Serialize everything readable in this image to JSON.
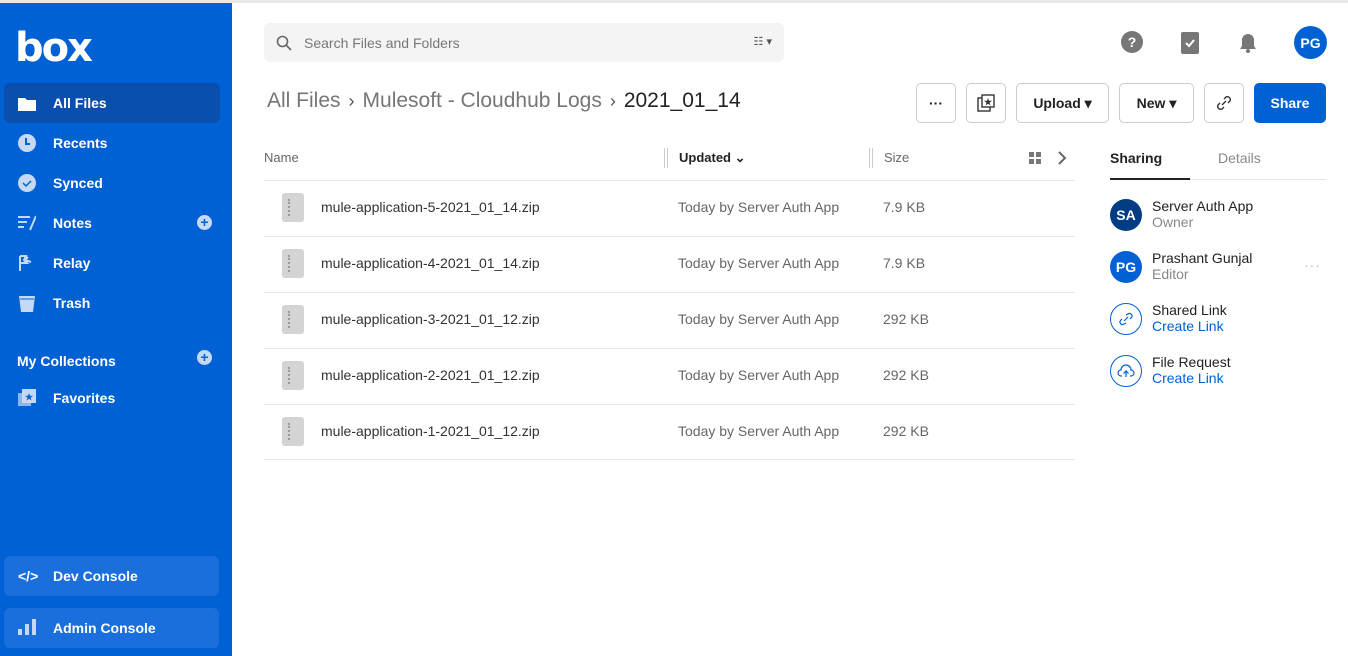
{
  "sidebar": {
    "logo": "box",
    "items": [
      {
        "label": "All Files",
        "icon": "folder-icon"
      },
      {
        "label": "Recents",
        "icon": "clock-icon"
      },
      {
        "label": "Synced",
        "icon": "check-circle-icon"
      },
      {
        "label": "Notes",
        "icon": "notes-icon"
      },
      {
        "label": "Relay",
        "icon": "relay-icon"
      },
      {
        "label": "Trash",
        "icon": "trash-icon"
      }
    ],
    "collections_label": "My Collections",
    "favorites": "Favorites",
    "dev_console": "Dev Console",
    "admin_console": "Admin Console"
  },
  "search": {
    "placeholder": "Search Files and Folders"
  },
  "user": {
    "initials": "PG"
  },
  "breadcrumb": {
    "root": "All Files",
    "parent": "Mulesoft - Cloudhub Logs",
    "current": "2021_01_14"
  },
  "toolbar": {
    "more": "···",
    "upload": "Upload ▾",
    "new": "New ▾",
    "share": "Share"
  },
  "table": {
    "headers": {
      "name": "Name",
      "updated": "Updated ⌄",
      "size": "Size"
    },
    "rows": [
      {
        "name": "mule-application-5-2021_01_14.zip",
        "updated": "Today by Server Auth App",
        "size": "7.9 KB"
      },
      {
        "name": "mule-application-4-2021_01_14.zip",
        "updated": "Today by Server Auth App",
        "size": "7.9 KB"
      },
      {
        "name": "mule-application-3-2021_01_12.zip",
        "updated": "Today by Server Auth App",
        "size": "292 KB"
      },
      {
        "name": "mule-application-2-2021_01_12.zip",
        "updated": "Today by Server Auth App",
        "size": "292 KB"
      },
      {
        "name": "mule-application-1-2021_01_12.zip",
        "updated": "Today by Server Auth App",
        "size": "292 KB"
      }
    ]
  },
  "panel": {
    "tabs": [
      "Sharing",
      "Details"
    ],
    "people": [
      {
        "initials": "SA",
        "name": "Server Auth App",
        "role": "Owner",
        "color": "#003c84"
      },
      {
        "initials": "PG",
        "name": "Prashant Gunjal",
        "role": "Editor",
        "color": "#0061d5"
      }
    ],
    "shared_link": {
      "title": "Shared Link",
      "action": "Create Link"
    },
    "file_request": {
      "title": "File Request",
      "action": "Create Link"
    },
    "more": "···"
  }
}
